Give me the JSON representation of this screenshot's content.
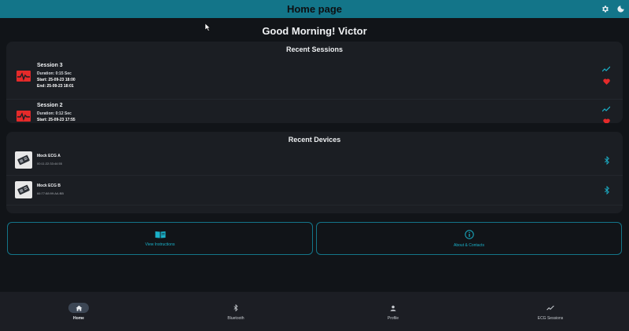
{
  "appbar": {
    "title": "Home page"
  },
  "greeting": "Good Morning! Victor",
  "recent_sessions": {
    "title": "Recent Sessions",
    "items": [
      {
        "name": "Session 3",
        "duration": "Duration: 0:15 Sec",
        "start": "Start: 25-09-23 18:00",
        "end": "End: 25-09-23 18:01"
      },
      {
        "name": "Session 2",
        "duration": "Duration: 0:12 Sec",
        "start": "Start: 25-09-23 17:55",
        "end": ""
      }
    ]
  },
  "recent_devices": {
    "title": "Recent Devices",
    "items": [
      {
        "name": "Mock ECG A",
        "mac": "00:11:22:33:44:55"
      },
      {
        "name": "Mock ECG B",
        "mac": "66:77:88:99:AA:BB"
      }
    ]
  },
  "actions": {
    "instructions_label": "View Instructions",
    "about_label": "About & Contacts"
  },
  "bottom_nav": {
    "items": [
      {
        "label": "Home",
        "icon": "home-icon",
        "active": true
      },
      {
        "label": "Bluetooth",
        "icon": "bluetooth-icon",
        "active": false
      },
      {
        "label": "Profile",
        "icon": "person-icon",
        "active": false
      },
      {
        "label": "ECG Sessions",
        "icon": "trend-icon",
        "active": false
      }
    ]
  },
  "colors": {
    "appbar": "#137589",
    "accent": "#1ab0c8",
    "background": "#111418",
    "card": "#1b1e23",
    "heart": "#e52a2a"
  }
}
